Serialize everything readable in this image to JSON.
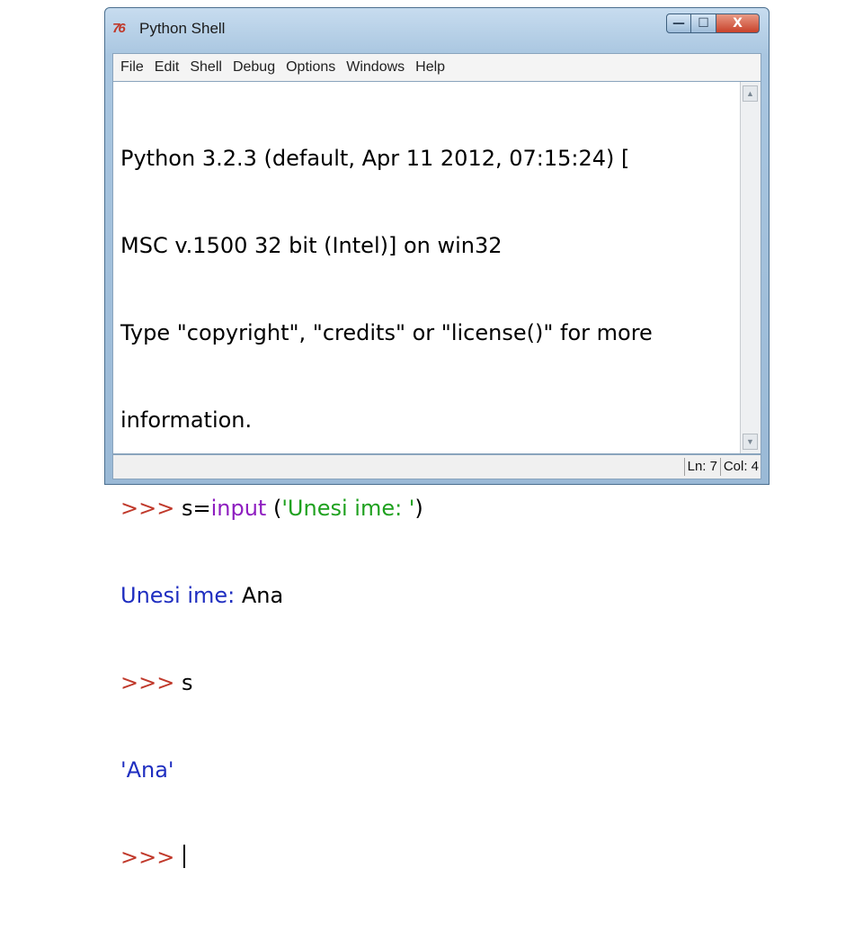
{
  "window": {
    "title": "Python Shell",
    "icon": "python-idle-icon",
    "buttons": {
      "minimize": "—",
      "maximize": "☐",
      "close": "X"
    }
  },
  "menu": [
    "File",
    "Edit",
    "Shell",
    "Debug",
    "Options",
    "Windows",
    "Help"
  ],
  "shell": {
    "banner": [
      "Python 3.2.3 (default, Apr 11 2012, 07:15:24) [",
      "MSC v.1500 32 bit (Intel)] on win32",
      "Type \"copyright\", \"credits\" or \"license()\" for more",
      "information."
    ],
    "prompt": ">>>",
    "line1": {
      "var": "s=",
      "func": "input",
      "open": " (",
      "string": "'Unesi ime: '",
      "close": ")"
    },
    "line2": {
      "stdout": "Unesi ime: ",
      "input": "Ana"
    },
    "line3": {
      "code": "s"
    },
    "line4": {
      "result": "'Ana'"
    }
  },
  "status": {
    "line": "Ln: 7",
    "col": "Col: 4"
  },
  "colors": {
    "prompt": "#c0392b",
    "builtin": "#8e1ec0",
    "string": "#1fa11f",
    "stdout": "#1f2ec0"
  }
}
